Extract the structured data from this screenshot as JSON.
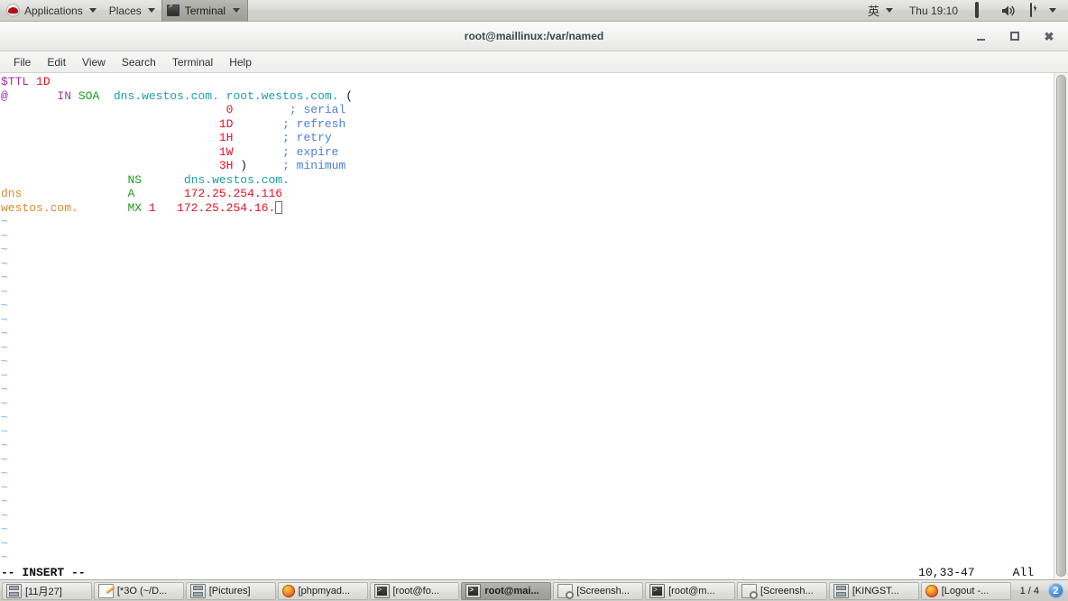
{
  "top_panel": {
    "logo_icon": "redhat-logo-icon",
    "menus": [
      {
        "label": "Applications",
        "icon": "caret-down-icon"
      },
      {
        "label": "Places",
        "icon": "caret-down-icon"
      }
    ],
    "window_item": {
      "label": "Terminal",
      "icon": "terminal-icon",
      "caret": "caret-down-icon"
    },
    "ime": {
      "label": "英",
      "caret": "caret-down-icon"
    },
    "clock": "Thu 19:10",
    "tray": [
      {
        "name": "display-icon"
      },
      {
        "name": "volume-icon"
      },
      {
        "name": "battery-icon"
      },
      {
        "name": "caret-down-icon"
      }
    ]
  },
  "window": {
    "title": "root@maillinux:/var/named",
    "buttons": {
      "minimize": "minimize-icon",
      "maximize": "maximize-icon",
      "close": "close-icon"
    }
  },
  "menu_bar": {
    "items": [
      "File",
      "Edit",
      "View",
      "Search",
      "Terminal",
      "Help"
    ]
  },
  "terminal": {
    "lines": [
      [
        {
          "t": "$TTL ",
          "c": "c-preproc"
        },
        {
          "t": "1D",
          "c": "c-number"
        }
      ],
      [
        {
          "t": "@",
          "c": "c-preproc"
        },
        {
          "t": "       ",
          "c": "c-plain"
        },
        {
          "t": "IN",
          "c": "c-keyword"
        },
        {
          "t": " ",
          "c": "c-plain"
        },
        {
          "t": "SOA",
          "c": "c-type"
        },
        {
          "t": "  ",
          "c": "c-plain"
        },
        {
          "t": "dns.westos.com. root.westos.com.",
          "c": "c-string"
        },
        {
          "t": " (",
          "c": "c-plain"
        }
      ],
      [
        {
          "t": "                                ",
          "c": "c-plain"
        },
        {
          "t": "0",
          "c": "c-number"
        },
        {
          "t": "        ",
          "c": "c-plain"
        },
        {
          "t": "; serial",
          "c": "c-comment"
        }
      ],
      [
        {
          "t": "                               ",
          "c": "c-plain"
        },
        {
          "t": "1D",
          "c": "c-number"
        },
        {
          "t": "       ",
          "c": "c-plain"
        },
        {
          "t": "; refresh",
          "c": "c-comment"
        }
      ],
      [
        {
          "t": "                               ",
          "c": "c-plain"
        },
        {
          "t": "1H",
          "c": "c-number"
        },
        {
          "t": "       ",
          "c": "c-plain"
        },
        {
          "t": "; retry",
          "c": "c-comment"
        }
      ],
      [
        {
          "t": "                               ",
          "c": "c-plain"
        },
        {
          "t": "1W",
          "c": "c-number"
        },
        {
          "t": "       ",
          "c": "c-plain"
        },
        {
          "t": "; expire",
          "c": "c-comment"
        }
      ],
      [
        {
          "t": "                               ",
          "c": "c-plain"
        },
        {
          "t": "3H",
          "c": "c-number"
        },
        {
          "t": " )",
          "c": "c-plain"
        },
        {
          "t": "     ",
          "c": "c-plain"
        },
        {
          "t": "; minimum",
          "c": "c-comment"
        }
      ],
      [
        {
          "t": "                  ",
          "c": "c-plain"
        },
        {
          "t": "NS",
          "c": "c-type"
        },
        {
          "t": "      ",
          "c": "c-plain"
        },
        {
          "t": "dns.westos.com.",
          "c": "c-string"
        }
      ],
      [
        {
          "t": "dns",
          "c": "c-ident"
        },
        {
          "t": "               ",
          "c": "c-plain"
        },
        {
          "t": "A",
          "c": "c-type"
        },
        {
          "t": "       ",
          "c": "c-plain"
        },
        {
          "t": "172.25.254.116",
          "c": "c-number"
        }
      ],
      [
        {
          "t": "westos.com.",
          "c": "c-ident"
        },
        {
          "t": "       ",
          "c": "c-plain"
        },
        {
          "t": "MX",
          "c": "c-type"
        },
        {
          "t": " ",
          "c": "c-plain"
        },
        {
          "t": "1",
          "c": "c-number"
        },
        {
          "t": "   ",
          "c": "c-plain"
        },
        {
          "t": "172.25.254.16.",
          "c": "c-number"
        }
      ]
    ],
    "empty_marker": "~",
    "empty_line_count": 25,
    "cursor": "block-cursor"
  },
  "status": {
    "mode": "-- INSERT --",
    "position": "10,33-47",
    "scroll": "All"
  },
  "taskbar": {
    "buttons": [
      {
        "label": "[11月27]",
        "icon": "drawer-icon",
        "active": false
      },
      {
        "label": "[*3O (~/D...",
        "icon": "editor-icon",
        "active": false
      },
      {
        "label": "[Pictures]",
        "icon": "drawer-icon",
        "active": false
      },
      {
        "label": "[phpmyad...",
        "icon": "firefox-icon",
        "active": false
      },
      {
        "label": "[root@fo...",
        "icon": "terminal-icon",
        "active": false
      },
      {
        "label": "root@mai...",
        "icon": "terminal-icon",
        "active": true
      },
      {
        "label": "[Screensh...",
        "icon": "screenshot-icon",
        "active": false
      },
      {
        "label": "[root@m...",
        "icon": "terminal-icon",
        "active": false
      },
      {
        "label": "[Screensh...",
        "icon": "screenshot-icon",
        "active": false
      },
      {
        "label": "[KINGST...",
        "icon": "drawer-icon",
        "active": false
      },
      {
        "label": "[Logout -...",
        "icon": "firefox-icon",
        "active": false
      }
    ],
    "pager": "1 / 4",
    "workspace_badge": "2"
  }
}
